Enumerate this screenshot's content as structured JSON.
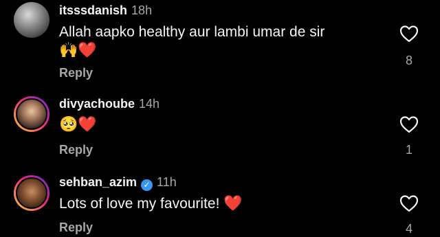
{
  "comments": [
    {
      "username": "itsssdanish",
      "time": "18h",
      "verified": false,
      "story_ring": false,
      "text": "Allah aapko healthy aur lambi umar de sir",
      "emojis": "🙌❤️",
      "reply_label": "Reply",
      "like_count": "8"
    },
    {
      "username": "divyachoube",
      "time": "14h",
      "verified": false,
      "story_ring": true,
      "text": "",
      "emojis": "🥺❤️",
      "reply_label": "Reply",
      "like_count": "1"
    },
    {
      "username": "sehban_azim",
      "time": "11h",
      "verified": true,
      "story_ring": true,
      "text": "Lots of love my favourite!",
      "emojis": "❤️",
      "reply_label": "Reply",
      "like_count": "4"
    }
  ],
  "icons": {
    "like": "heart-outline-icon",
    "verified": "verified-badge-icon"
  },
  "colors": {
    "background": "#000000",
    "primary_text": "#f5f5f5",
    "secondary_text": "#a8a8a8",
    "verified": "#3897f0"
  }
}
